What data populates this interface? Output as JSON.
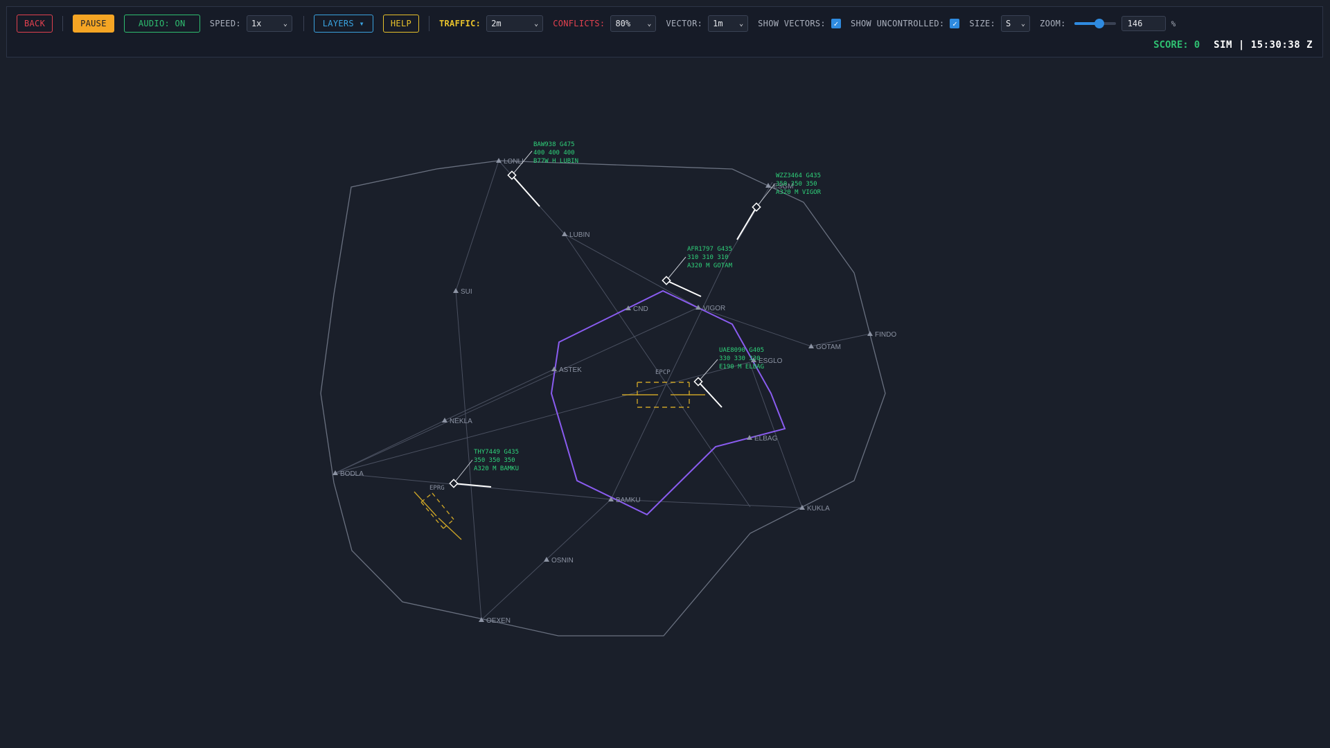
{
  "toolbar": {
    "back_label": "BACK",
    "pause_label": "PAUSE",
    "audio_label": "AUDIO: ON",
    "speed_label": "SPEED:",
    "speed_value": "1x",
    "layers_label": "LAYERS ▾",
    "help_label": "HELP",
    "traffic_label": "TRAFFIC:",
    "traffic_value": "2m",
    "conflicts_label": "CONFLICTS:",
    "conflicts_value": "80%",
    "vector_label": "VECTOR:",
    "vector_value": "1m",
    "show_vectors_label": "SHOW VECTORS:",
    "show_vectors_checked": true,
    "show_uncontrolled_label": "SHOW UNCONTROLLED:",
    "show_uncontrolled_checked": true,
    "size_label": "SIZE:",
    "size_value": "S",
    "zoom_label": "ZOOM:",
    "zoom_value": "146",
    "zoom_unit": "%",
    "zoom_fraction": 0.6
  },
  "status": {
    "score_label": "SCORE:",
    "score_value": "0",
    "clock": "SIM | 15:30:38 Z"
  },
  "colors": {
    "sector": "#8a5cf0",
    "boundary": "#6a7180",
    "aircraft": "#2fd27a",
    "runway": "#c9a227"
  },
  "airports": [
    {
      "name": "EPCP"
    },
    {
      "name": "EPRG"
    }
  ],
  "fixes": [
    {
      "name": "LONLI"
    },
    {
      "name": "LUBIN"
    },
    {
      "name": "SUI"
    },
    {
      "name": "CND"
    },
    {
      "name": "VIGOR"
    },
    {
      "name": "ASTEK"
    },
    {
      "name": "GOTAM"
    },
    {
      "name": "FINDO"
    },
    {
      "name": "ESGLO"
    },
    {
      "name": "NEKLA"
    },
    {
      "name": "ELBAG"
    },
    {
      "name": "BODLA"
    },
    {
      "name": "BAMKU"
    },
    {
      "name": "KUKLA"
    },
    {
      "name": "OSNIN"
    },
    {
      "name": "OEXEN"
    },
    {
      "name": "ESGM"
    }
  ],
  "aircraft": [
    {
      "callsign": "BAW938 G475",
      "line2": "400 400 400",
      "line3": "B77W H   LUBIN"
    },
    {
      "callsign": "WZZ3464 G435",
      "line2": "350 350 350",
      "line3": "A320 M   VIGOR"
    },
    {
      "callsign": "AFR1797 G435",
      "line2": "310 310 310",
      "line3": "A320 M   GOTAM"
    },
    {
      "callsign": "UAE8090 G405",
      "line2": "330 330 330",
      "line3": "E190 M   ELBAG"
    },
    {
      "callsign": "THY7449 G435",
      "line2": "350 350 350",
      "line3": "A320 M   BAMKU"
    }
  ]
}
